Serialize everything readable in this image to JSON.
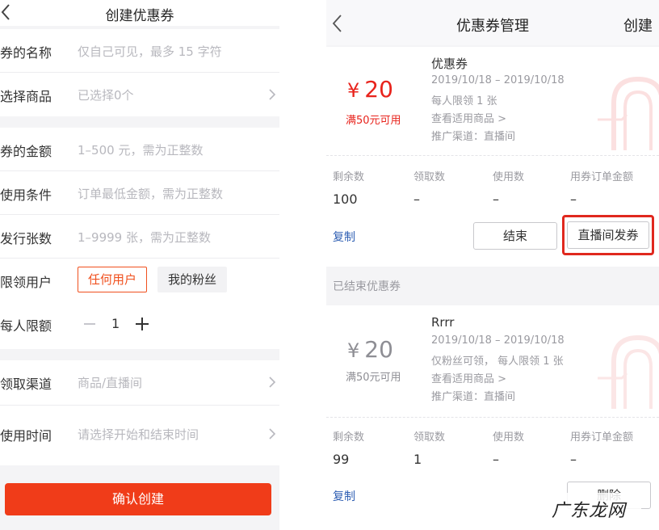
{
  "left": {
    "header": {
      "title": "创建优惠券"
    },
    "fields": {
      "name": {
        "label": "券的名称",
        "placeholder": "仅自己可见，最多 15 字符"
      },
      "goods": {
        "label": "选择商品",
        "value": "已选择0个"
      },
      "amount": {
        "label": "券的金额",
        "placeholder": "1–500 元，需为正整数"
      },
      "condition": {
        "label": "使用条件",
        "placeholder": "订单最低金额，需为正整数"
      },
      "quantity": {
        "label": "发行张数",
        "placeholder": "1–9999 张，需为正整数"
      },
      "users": {
        "label": "限领用户",
        "options": [
          "任何用户",
          "我的粉丝"
        ],
        "selected": "任何用户"
      },
      "per_limit": {
        "label": "每人限额",
        "value": "1"
      },
      "channel": {
        "label": "领取渠道",
        "placeholder": "商品/直播间"
      },
      "time": {
        "label": "使用时间",
        "placeholder": "请选择开始和结束时间"
      }
    },
    "confirm_label": "确认创建"
  },
  "right": {
    "header": {
      "title": "优惠券管理",
      "create_label": "创建"
    },
    "active_coupon": {
      "currency": "¥",
      "amount": "20",
      "condition": "满50元可用",
      "name": "优惠券",
      "dates": "2019/10/18 – 2019/10/18",
      "limit": "每人限领 1 张",
      "view_goods": "查看适用商品 >",
      "channel": "推广渠道：直播间",
      "stats_headers": [
        "剩余数",
        "领取数",
        "使用数",
        "用券订单金额"
      ],
      "stats_values": [
        "100",
        "–",
        "–",
        "–"
      ],
      "copy_label": "复制",
      "end_label": "结束",
      "live_label": "直播间发券"
    },
    "ended_section_label": "已结束优惠券",
    "ended_coupon": {
      "currency": "¥",
      "amount": "20",
      "condition": "满50元可用",
      "name": "Rrrr",
      "dates": "2019/10/18 – 2019/10/18",
      "limit": "仅粉丝可领， 每人限领 1 张",
      "view_goods": "查看适用商品 >",
      "channel": "推广渠道：直播间",
      "stats_headers": [
        "剩余数",
        "领取数",
        "使用数",
        "用券订单金额"
      ],
      "stats_values": [
        "99",
        "1",
        "–",
        "–"
      ],
      "copy_label": "复制",
      "delete_label": "删除"
    }
  },
  "watermark": "广东龙网",
  "colors": {
    "accent": "#f03c19",
    "price_red": "#e8231c",
    "highlight": "#e0281e",
    "link": "#2f5fb3"
  }
}
